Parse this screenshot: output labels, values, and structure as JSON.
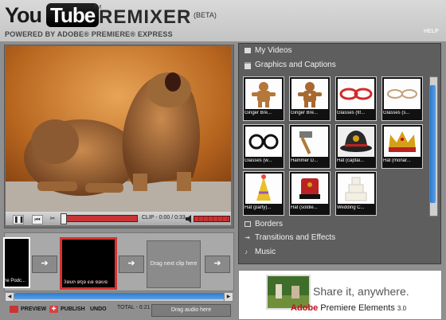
{
  "header": {
    "logo_you": "You",
    "logo_tube": "Tube",
    "logo_tm": "TM",
    "logo_remixer": "REMIXER",
    "logo_beta": "(BETA)",
    "powered_by": "POWERED BY ADOBE® PREMIERE® EXPRESS",
    "help": "HELP"
  },
  "player": {
    "pause_icon": "pause-icon",
    "rewind_icon": "skip-back-icon",
    "cut_icon": "scissors-icon",
    "clip_time": "CLIP - 0:00 / 0:33",
    "volume_icon": "speaker-icon",
    "progress": 0.0
  },
  "timeline": {
    "clips": [
      {
        "label": "he Podc..."
      },
      {
        "label": "3ອນຕ ອຖອ ຄອ ຂອບຂ"
      }
    ],
    "arrow_glyph": "➔",
    "drop_slot": "Drag next clip here"
  },
  "toolbar": {
    "preview": "PREVIEW",
    "publish": "PUBLISH",
    "undo": "UNDO",
    "total": "TOTAL - 6:21",
    "audio_drop": "Drag audio here"
  },
  "library": {
    "my_videos": "My Videos",
    "graphics": "Graphics and Captions",
    "thumbs": [
      {
        "label": "Ginger Bre...",
        "icon": "gingerbread-icon"
      },
      {
        "label": "Ginger Bre...",
        "icon": "gingerbread-icon"
      },
      {
        "label": "Glasses (fif...",
        "icon": "glasses-icon"
      },
      {
        "label": "Glasses (s...",
        "icon": "glasses-icon"
      },
      {
        "label": "Glasses (w...",
        "icon": "glasses-icon"
      },
      {
        "label": "Hammer D...",
        "icon": "hammer-icon"
      },
      {
        "label": "Hat (captai...",
        "icon": "hat-icon"
      },
      {
        "label": "Hat (monar...",
        "icon": "crown-icon"
      },
      {
        "label": "Hat (party)...",
        "icon": "party-hat-icon"
      },
      {
        "label": "Hat (soldie...",
        "icon": "hat-icon"
      },
      {
        "label": "Wedding C...",
        "icon": "cake-icon"
      }
    ],
    "borders": "Borders",
    "transitions": "Transitions and Effects",
    "music": "Music"
  },
  "ad": {
    "line1": "Share it, anywhere.",
    "brand": "Adobe",
    "product": "Premiere",
    "product2": "Elements",
    "version": "3.0"
  },
  "colors": {
    "accent_red": "#c93535",
    "scroll_blue": "#2a7bd1"
  }
}
